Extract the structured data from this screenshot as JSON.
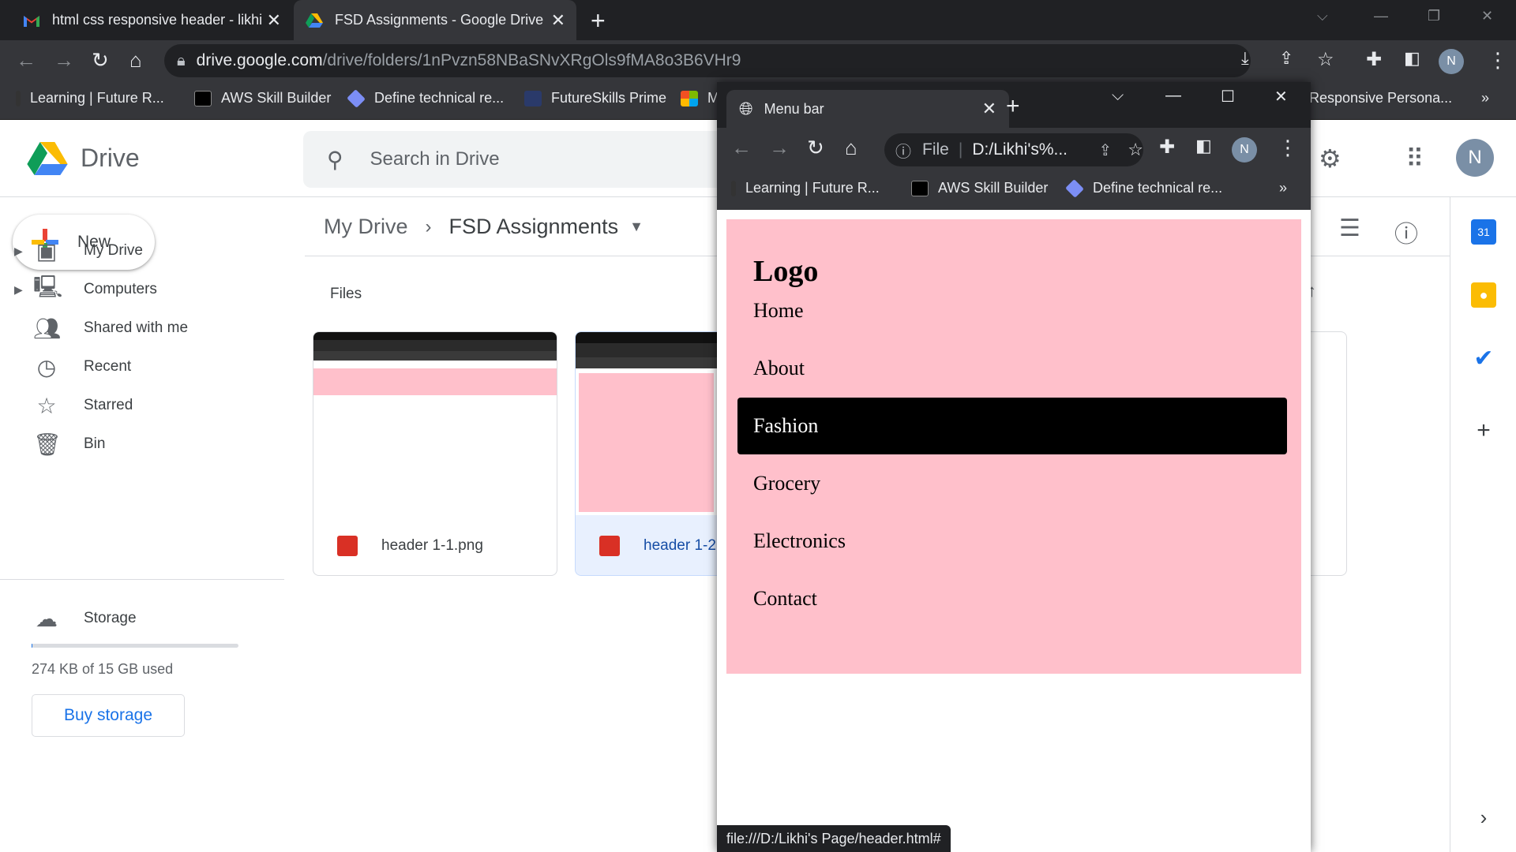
{
  "browser": {
    "tabs": [
      {
        "title": "html css responsive header - likhi",
        "favicon": "gmail-icon"
      },
      {
        "title": "FSD Assignments - Google Drive",
        "favicon": "drive-icon"
      }
    ],
    "url_host": "drive.google.com",
    "url_path": "/drive/folders/1nPvzn58NBaSNvXRgOls9fMA8o3B6VHr9",
    "profile_initial": "N",
    "bookmarks": [
      "Learning | Future R...",
      "AWS Skill Builder",
      "Define technical re...",
      "FutureSkills Prime",
      "M",
      "Responsive Persona..."
    ]
  },
  "drive": {
    "app_name": "Drive",
    "search_placeholder": "Search in Drive",
    "new_label": "New",
    "nav": [
      {
        "label": "My Drive",
        "icon": "my-drive-icon"
      },
      {
        "label": "Computers",
        "icon": "computers-icon"
      },
      {
        "label": "Shared with me",
        "icon": "shared-icon"
      },
      {
        "label": "Recent",
        "icon": "clock-icon"
      },
      {
        "label": "Starred",
        "icon": "star-icon"
      },
      {
        "label": "Bin",
        "icon": "trash-icon"
      }
    ],
    "storage_label": "Storage",
    "storage_used_fraction": 0.0,
    "storage_text": "274 KB of 15 GB used",
    "buy_storage_label": "Buy storage",
    "breadcrumb": {
      "root": "My Drive",
      "current": "FSD Assignments"
    },
    "files_label": "Files",
    "files": [
      {
        "name": "header 1-1.png",
        "selected": false
      },
      {
        "name": "header 1-2",
        "selected": true
      }
    ],
    "avatar_initial": "N"
  },
  "popup": {
    "tab_title": "Menu bar",
    "omnibox_scheme": "File",
    "omnibox_url": "D:/Likhi's%...",
    "profile_initial": "N",
    "bookmarks": [
      "Learning | Future R...",
      "AWS Skill Builder",
      "Define technical re..."
    ],
    "page": {
      "logo": "Logo",
      "menu": [
        "Home",
        "About",
        "Fashion",
        "Grocery",
        "Electronics",
        "Contact"
      ],
      "active_index": 2,
      "menu_bg": "#ffc0cb"
    },
    "status_url": "file:///D:/Likhi's Page/header.html#"
  }
}
